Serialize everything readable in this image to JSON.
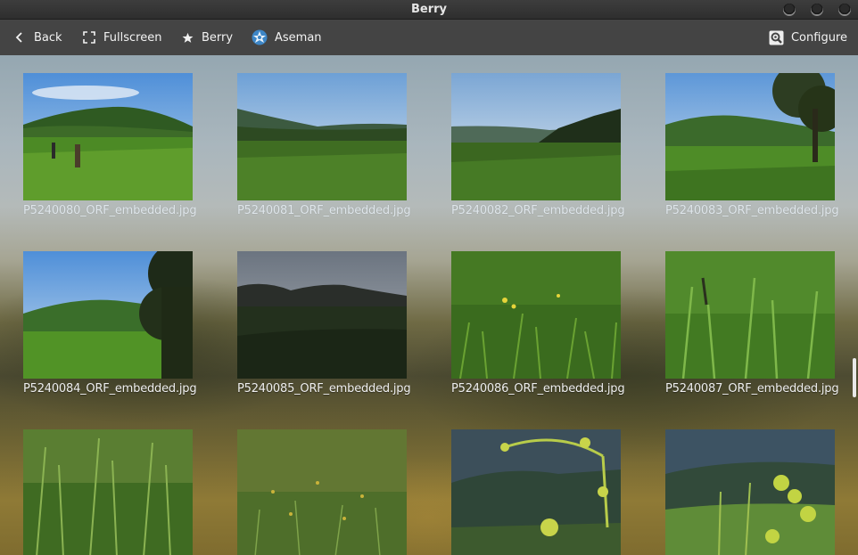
{
  "window": {
    "title": "Berry"
  },
  "toolbar": {
    "back_label": "Back",
    "fullscreen_label": "Fullscreen",
    "berry_label": "Berry",
    "aseman_label": "Aseman",
    "configure_label": "Configure"
  },
  "gallery": {
    "items": [
      {
        "filename": "P5240080_ORF_embedded.jpg"
      },
      {
        "filename": "P5240081_ORF_embedded.jpg"
      },
      {
        "filename": "P5240082_ORF_embedded.jpg"
      },
      {
        "filename": "P5240083_ORF_embedded.jpg"
      },
      {
        "filename": "P5240084_ORF_embedded.jpg"
      },
      {
        "filename": "P5240085_ORF_embedded.jpg"
      },
      {
        "filename": "P5240086_ORF_embedded.jpg"
      },
      {
        "filename": "P5240087_ORF_embedded.jpg"
      },
      {
        "filename": ""
      },
      {
        "filename": ""
      },
      {
        "filename": ""
      },
      {
        "filename": ""
      }
    ]
  }
}
